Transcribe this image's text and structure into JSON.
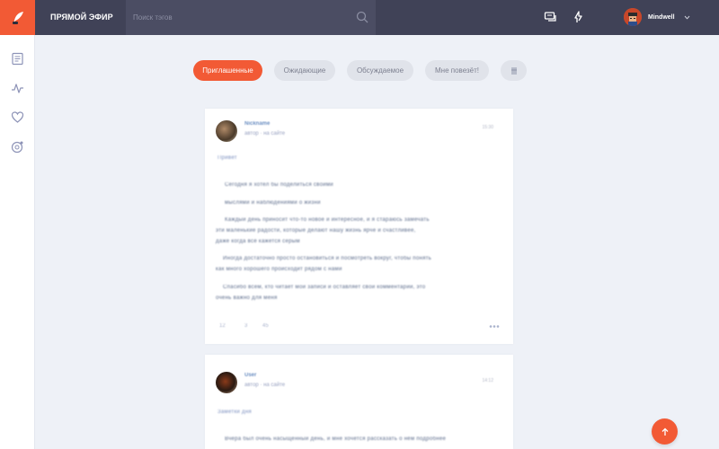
{
  "app": {
    "title": "ПРЯМОЙ ЭФИР",
    "accent_color": "#f25a35",
    "topbar_color": "#404257"
  },
  "search": {
    "placeholder": "Поиск тэгов"
  },
  "topbar_icons": [
    "messages-icon",
    "notifications-icon"
  ],
  "user": {
    "name": "Mindwell"
  },
  "sidebar": {
    "items": [
      {
        "icon": "feed-icon"
      },
      {
        "icon": "activity-icon"
      },
      {
        "icon": "favorites-icon"
      },
      {
        "icon": "discover-icon"
      }
    ]
  },
  "tabs": [
    {
      "label": "Приглашенные",
      "active": true
    },
    {
      "label": "Ожидающие",
      "active": false
    },
    {
      "label": "Обсуждаемое",
      "active": false
    },
    {
      "label": "Мне повезёт!",
      "active": false
    }
  ],
  "posts": [
    {
      "author": "Nickname",
      "meta": "автор · на сайте",
      "time": "15:30",
      "title": "Привет",
      "lines": [
        "Сегодня я хотел бы поделиться своими",
        "мыслями и наблюдениями о жизни",
        "Каждый день приносит что-то новое и интересное, и я стараюсь замечать",
        "эти маленькие радости, которые делают нашу жизнь ярче и счастливее,",
        "даже когда всё кажется серым",
        "Иногда достаточно просто остановиться и посмотреть вокруг, чтобы понять",
        "как много хорошего происходит рядом с нами",
        "Спасибо всем, кто читает мои записи и оставляет свои комментарии, это",
        "очень важно для меня"
      ],
      "stats": [
        "12",
        "3",
        "45"
      ]
    },
    {
      "author": "User",
      "meta": "автор · на сайте",
      "time": "14:12",
      "title": "Заметки дня",
      "lines": [
        "Вчера был очень насыщенный день, и мне хочется рассказать о нём подробнее"
      ]
    }
  ]
}
